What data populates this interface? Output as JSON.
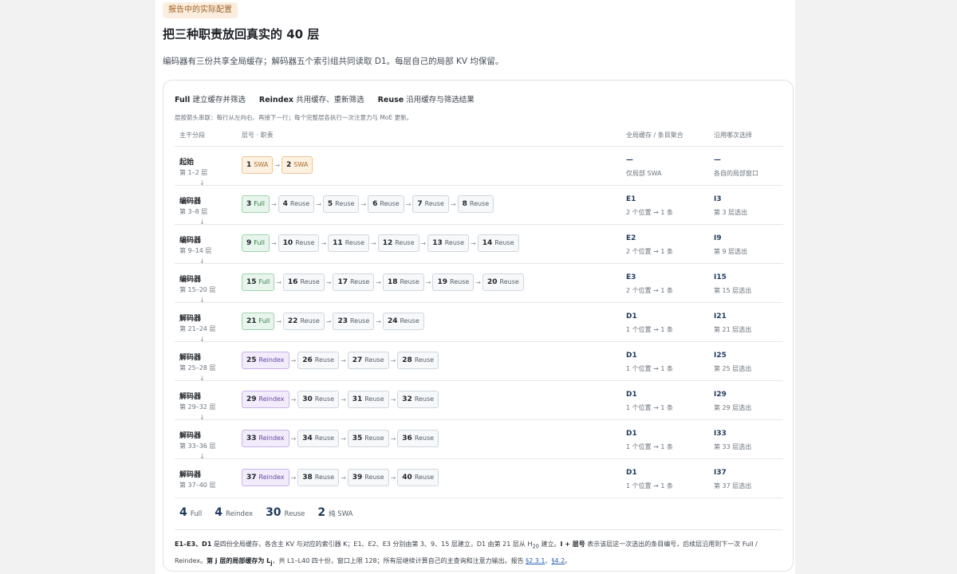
{
  "header": {
    "eyebrow": "报告中的实际配置",
    "title": "把三种职责放回真实的 40 层",
    "lead": "编码器有三份共享全局缓存；解码器五个索引组共同读取 D1。每层自己的局部 KV 均保留。"
  },
  "legend": {
    "items": [
      {
        "term": "Full",
        "desc": "建立缓存并筛选"
      },
      {
        "term": "Reindex",
        "desc": "共用缓存、重新筛选"
      },
      {
        "term": "Reuse",
        "desc": "沿用缓存与筛选结果"
      }
    ],
    "note": "层按箭头串联：每行从左向右、再接下一行；每个完整层各执行一次注意力与 MoE 更新。"
  },
  "columns": {
    "segment": "主干分段",
    "layers": "层号 · 职责",
    "cache": "全局缓存 / 条目聚合",
    "reuse": "沿用哪次选择"
  },
  "rows": [
    {
      "name": "起始",
      "range": "第 1–2 层",
      "chips": [
        {
          "num": "1",
          "role": "SWA",
          "kind": "swa"
        },
        {
          "num": "2",
          "role": "SWA",
          "kind": "swa"
        }
      ],
      "cache_id": "—",
      "cache_note": "仅局部 SWA",
      "reuse_id": "—",
      "reuse_note": "各自的局部窗口"
    },
    {
      "name": "编码器",
      "range": "第 3–8 层",
      "chips": [
        {
          "num": "3",
          "role": "Full",
          "kind": "full"
        },
        {
          "num": "4",
          "role": "Reuse",
          "kind": "reuse"
        },
        {
          "num": "5",
          "role": "Reuse",
          "kind": "reuse"
        },
        {
          "num": "6",
          "role": "Reuse",
          "kind": "reuse"
        },
        {
          "num": "7",
          "role": "Reuse",
          "kind": "reuse"
        },
        {
          "num": "8",
          "role": "Reuse",
          "kind": "reuse"
        }
      ],
      "cache_id": "E1",
      "cache_note": "2 个位置 → 1 条",
      "reuse_id": "I3",
      "reuse_note": "第 3 层选出"
    },
    {
      "name": "编码器",
      "range": "第 9–14 层",
      "chips": [
        {
          "num": "9",
          "role": "Full",
          "kind": "full"
        },
        {
          "num": "10",
          "role": "Reuse",
          "kind": "reuse"
        },
        {
          "num": "11",
          "role": "Reuse",
          "kind": "reuse"
        },
        {
          "num": "12",
          "role": "Reuse",
          "kind": "reuse"
        },
        {
          "num": "13",
          "role": "Reuse",
          "kind": "reuse"
        },
        {
          "num": "14",
          "role": "Reuse",
          "kind": "reuse"
        }
      ],
      "cache_id": "E2",
      "cache_note": "2 个位置 → 1 条",
      "reuse_id": "I9",
      "reuse_note": "第 9 层选出"
    },
    {
      "name": "编码器",
      "range": "第 15–20 层",
      "chips": [
        {
          "num": "15",
          "role": "Full",
          "kind": "full"
        },
        {
          "num": "16",
          "role": "Reuse",
          "kind": "reuse"
        },
        {
          "num": "17",
          "role": "Reuse",
          "kind": "reuse"
        },
        {
          "num": "18",
          "role": "Reuse",
          "kind": "reuse"
        },
        {
          "num": "19",
          "role": "Reuse",
          "kind": "reuse"
        },
        {
          "num": "20",
          "role": "Reuse",
          "kind": "reuse"
        }
      ],
      "cache_id": "E3",
      "cache_note": "2 个位置 → 1 条",
      "reuse_id": "I15",
      "reuse_note": "第 15 层选出"
    },
    {
      "name": "解码器",
      "range": "第 21–24 层",
      "chips": [
        {
          "num": "21",
          "role": "Full",
          "kind": "full"
        },
        {
          "num": "22",
          "role": "Reuse",
          "kind": "reuse"
        },
        {
          "num": "23",
          "role": "Reuse",
          "kind": "reuse"
        },
        {
          "num": "24",
          "role": "Reuse",
          "kind": "reuse"
        }
      ],
      "cache_id": "D1",
      "cache_note": "1 个位置 → 1 条",
      "reuse_id": "I21",
      "reuse_note": "第 21 层选出"
    },
    {
      "name": "解码器",
      "range": "第 25–28 层",
      "chips": [
        {
          "num": "25",
          "role": "Reindex",
          "kind": "reindex"
        },
        {
          "num": "26",
          "role": "Reuse",
          "kind": "reuse"
        },
        {
          "num": "27",
          "role": "Reuse",
          "kind": "reuse"
        },
        {
          "num": "28",
          "role": "Reuse",
          "kind": "reuse"
        }
      ],
      "cache_id": "D1",
      "cache_note": "1 个位置 → 1 条",
      "reuse_id": "I25",
      "reuse_note": "第 25 层选出"
    },
    {
      "name": "解码器",
      "range": "第 29–32 层",
      "chips": [
        {
          "num": "29",
          "role": "Reindex",
          "kind": "reindex"
        },
        {
          "num": "30",
          "role": "Reuse",
          "kind": "reuse"
        },
        {
          "num": "31",
          "role": "Reuse",
          "kind": "reuse"
        },
        {
          "num": "32",
          "role": "Reuse",
          "kind": "reuse"
        }
      ],
      "cache_id": "D1",
      "cache_note": "1 个位置 → 1 条",
      "reuse_id": "I29",
      "reuse_note": "第 29 层选出"
    },
    {
      "name": "解码器",
      "range": "第 33–36 层",
      "chips": [
        {
          "num": "33",
          "role": "Reindex",
          "kind": "reindex"
        },
        {
          "num": "34",
          "role": "Reuse",
          "kind": "reuse"
        },
        {
          "num": "35",
          "role": "Reuse",
          "kind": "reuse"
        },
        {
          "num": "36",
          "role": "Reuse",
          "kind": "reuse"
        }
      ],
      "cache_id": "D1",
      "cache_note": "1 个位置 → 1 条",
      "reuse_id": "I33",
      "reuse_note": "第 33 层选出"
    },
    {
      "name": "解码器",
      "range": "第 37–40 层",
      "chips": [
        {
          "num": "37",
          "role": "Reindex",
          "kind": "reindex"
        },
        {
          "num": "38",
          "role": "Reuse",
          "kind": "reuse"
        },
        {
          "num": "39",
          "role": "Reuse",
          "kind": "reuse"
        },
        {
          "num": "40",
          "role": "Reuse",
          "kind": "reuse"
        }
      ],
      "cache_id": "D1",
      "cache_note": "1 个位置 → 1 条",
      "reuse_id": "I37",
      "reuse_note": "第 37 层选出"
    }
  ],
  "down_arrow": "↓",
  "chain_arrow": "→",
  "summary": [
    {
      "num": "4",
      "label": "Full"
    },
    {
      "num": "4",
      "label": "Reindex"
    },
    {
      "num": "30",
      "label": "Reuse"
    },
    {
      "num": "2",
      "label": "纯 SWA"
    }
  ],
  "footnote": {
    "b1": "E1–E3、D1",
    "t1": " 是四份全局缓存，各含主 KV 与对应的索引器 K；E1、E2、E3 分别由第 3、9、15 层建立，D1 由第 21 层从 H",
    "sub": "20",
    "t2": " 建立。",
    "b2": "I + 层号",
    "t3": " 表示该层这一次选出的条目编号，后续层沿用到下一次 Full / Reindex。",
    "b3": "第 j 层的局部缓存为 L",
    "b3sub": "j",
    "t4": "，共 L1–L40 四十份，窗口上限 128；所有层继续计算自己的主查询和注意力输出。报告 ",
    "link1": "§2.3.1",
    "sep": "、",
    "link2": "§4.2",
    "end": "。"
  },
  "colors": {
    "swa": "#a86a2a",
    "full": "#2f7a44",
    "reindex": "#6b46a8",
    "reuse": "#57606a",
    "accent": "#1e3a5f",
    "link": "#1f5fb8"
  }
}
